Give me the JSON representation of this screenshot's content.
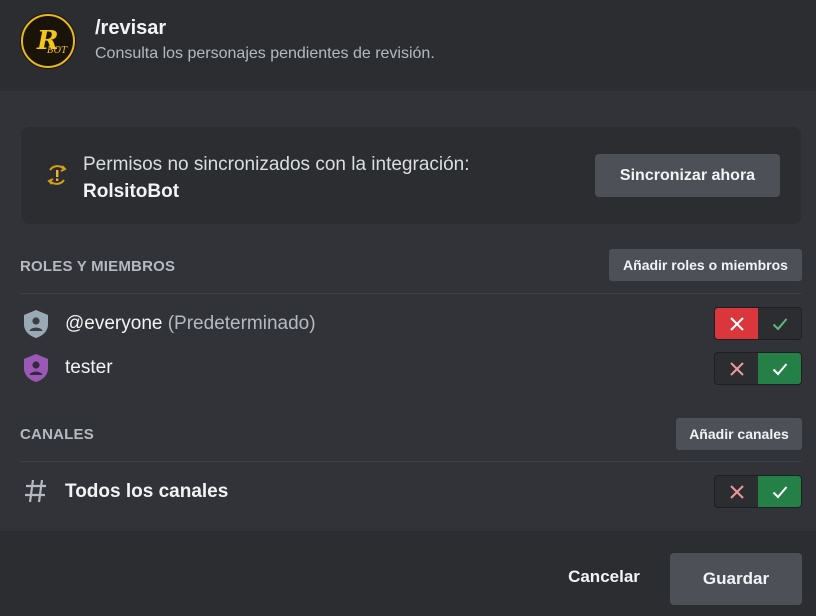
{
  "header": {
    "avatar_icon": "rolsito-bot-logo",
    "logo_letter": "R",
    "logo_text": "BOT",
    "command": "/revisar",
    "description": "Consulta los personajes pendientes de revisión."
  },
  "sync_banner": {
    "icon": "sync-warning-icon",
    "message": "Permisos no sincronizados con la integración:",
    "integration": "RolsitoBot",
    "button_label": "Sincronizar ahora"
  },
  "roles_section": {
    "title": "ROLES Y MIEMBROS",
    "add_button_label": "Añadir roles o miembros",
    "items": [
      {
        "name": "@everyone",
        "suffix": "(Predeterminado)",
        "icon": "role-shield-icon",
        "icon_color": "#99aab5",
        "state": "deny"
      },
      {
        "name": "tester",
        "suffix": "",
        "icon": "role-shield-icon",
        "icon_color": "#9b59b6",
        "state": "allow"
      }
    ]
  },
  "channels_section": {
    "title": "CANALES",
    "add_button_label": "Añadir canales",
    "items": [
      {
        "name": "Todos los canales",
        "icon": "hash-icon",
        "state": "allow"
      }
    ]
  },
  "footer": {
    "cancel_label": "Cancelar",
    "save_label": "Guardar"
  },
  "colors": {
    "deny_active": "#da373c",
    "allow_active": "#248046",
    "deny_inactive_icon": "#f0999c",
    "allow_inactive_icon": "#5fb97f"
  }
}
